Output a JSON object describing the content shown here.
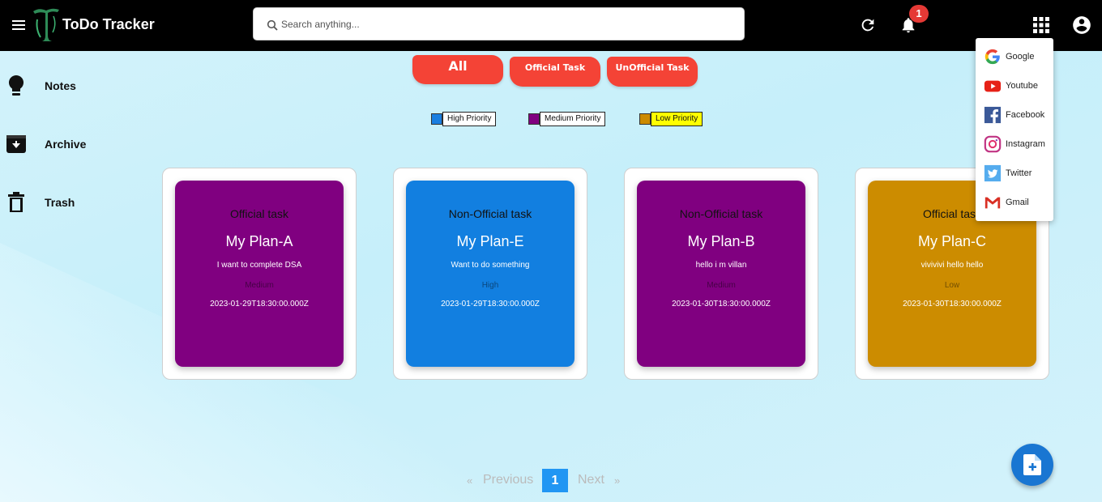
{
  "header": {
    "app_title": "ToDo Tracker",
    "search_placeholder": "Search anything...",
    "notification_count": "1"
  },
  "sidebar": {
    "items": [
      {
        "label": "Notes",
        "icon": "lightbulb-icon"
      },
      {
        "label": "Archive",
        "icon": "archive-icon"
      },
      {
        "label": "Trash",
        "icon": "trash-icon"
      }
    ]
  },
  "filters": {
    "all": "All",
    "official": "Official Task",
    "unofficial": "UnOfficial Task"
  },
  "legend": [
    {
      "label": "High Priority",
      "color": "#1a7ee0"
    },
    {
      "label": "Medium Priority",
      "color": "#800080"
    },
    {
      "label": "Low Priority",
      "color": "#cc8a00"
    }
  ],
  "cards": [
    {
      "type": "Official task",
      "title": "My Plan-A",
      "description": "I want to complete DSA",
      "priority": "Medium",
      "date": "2023-01-29T18:30:00.000Z",
      "color": "#800080"
    },
    {
      "type": "Non-Official task",
      "title": "My Plan-E",
      "description": "Want to do something",
      "priority": "High",
      "date": "2023-01-29T18:30:00.000Z",
      "color": "#127fe0"
    },
    {
      "type": "Non-Official task",
      "title": "My Plan-B",
      "description": "hello i m villan",
      "priority": "Medium",
      "date": "2023-01-30T18:30:00.000Z",
      "color": "#800080"
    },
    {
      "type": "Official task",
      "title": "My Plan-C",
      "description": "vivivivi hello hello",
      "priority": "Low",
      "date": "2023-01-30T18:30:00.000Z",
      "color": "#cc8c00"
    }
  ],
  "apps_menu": [
    {
      "label": "Google",
      "icon": "google-icon"
    },
    {
      "label": "Youtube",
      "icon": "youtube-icon"
    },
    {
      "label": "Facebook",
      "icon": "facebook-icon"
    },
    {
      "label": "Instagram",
      "icon": "instagram-icon"
    },
    {
      "label": "Twitter",
      "icon": "twitter-icon"
    },
    {
      "label": "Gmail",
      "icon": "gmail-icon"
    }
  ],
  "pagination": {
    "first": "«",
    "previous": "Previous",
    "current": "1",
    "next": "Next",
    "last": "»"
  },
  "colors": {
    "topbar": "#000000",
    "accent_red": "#f44336",
    "accent_blue": "#2196f3"
  }
}
